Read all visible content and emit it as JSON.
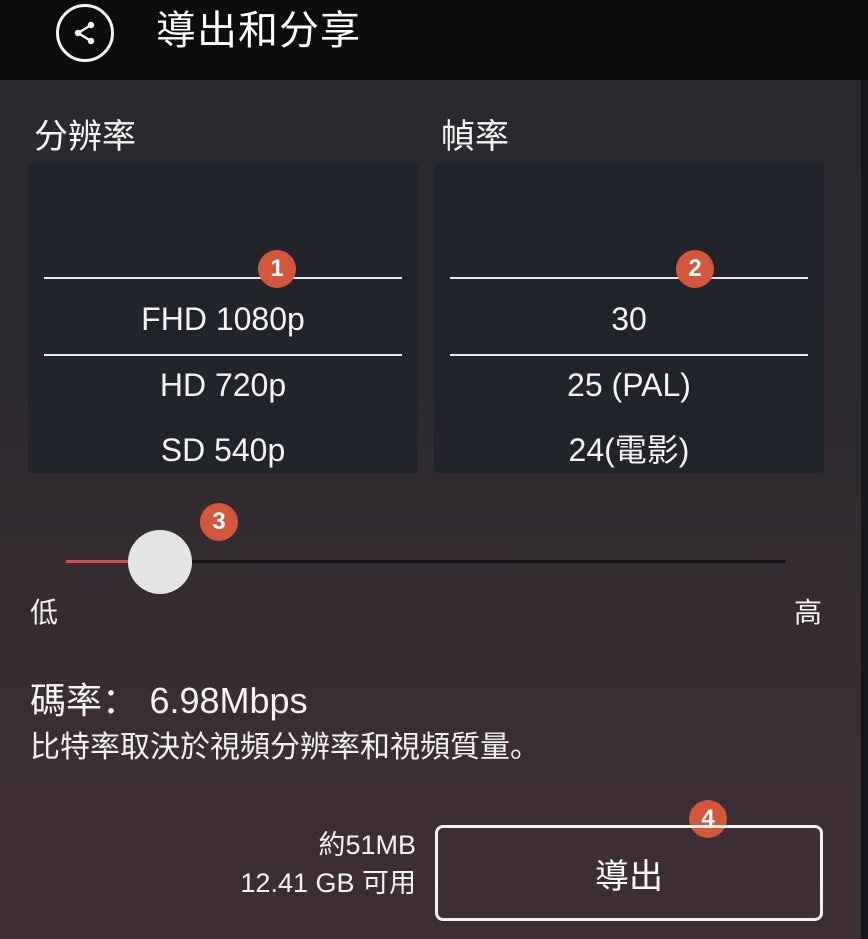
{
  "header": {
    "title": "導出和分享",
    "back_icon": "share-back-icon"
  },
  "resolution": {
    "label": "分辨率",
    "options": [
      "FHD 1080p",
      "HD 720p",
      "SD 540p"
    ],
    "selected": "FHD 1080p"
  },
  "framerate": {
    "label": "幀率",
    "options": [
      "30",
      "25 (PAL)",
      "24(電影)"
    ],
    "selected": "30"
  },
  "quality_slider": {
    "min_label": "低",
    "max_label": "高",
    "value_fraction": 0.13
  },
  "bitrate": {
    "label": "碼率：",
    "value": "6.98Mbps",
    "description": "比特率取決於視頻分辨率和視頻質量。"
  },
  "export": {
    "estimated_size": "約51MB",
    "available": "12.41 GB 可用",
    "button_label": "導出"
  },
  "badges": [
    "1",
    "2",
    "3",
    "4"
  ],
  "colors": {
    "accent": "#e04a4a",
    "badge": "#d5573b"
  }
}
